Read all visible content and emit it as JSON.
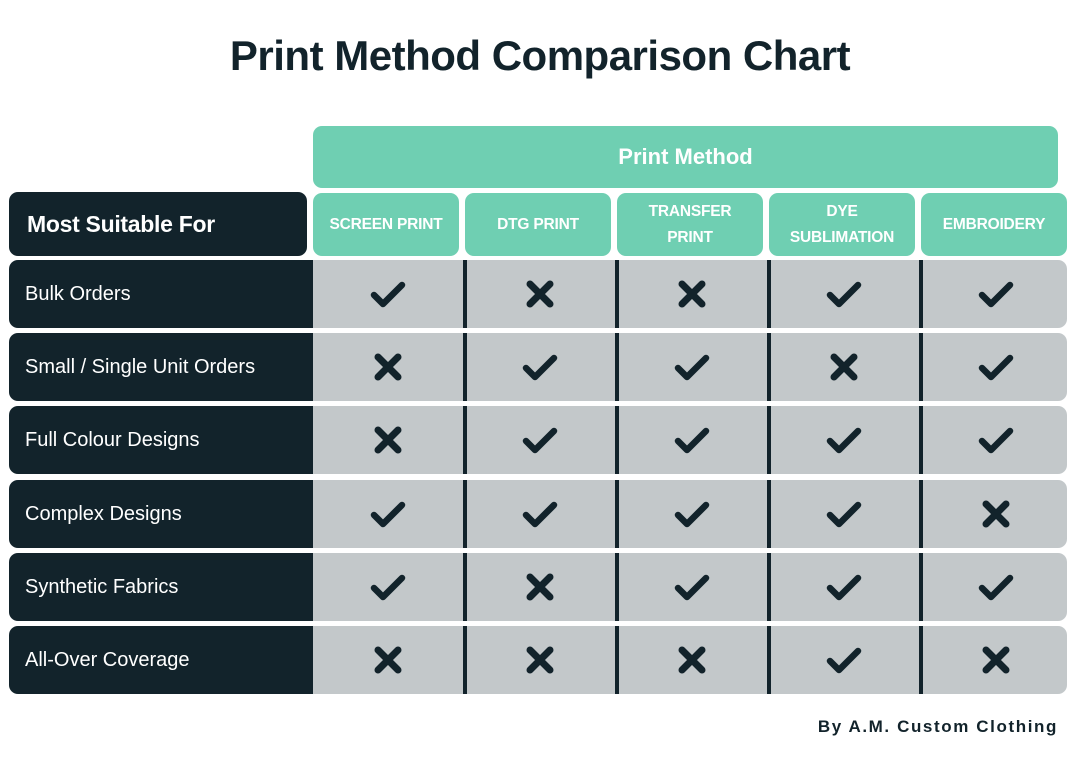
{
  "chart_data": {
    "type": "table",
    "title": "Print Method Comparison Chart",
    "column_group_label": "Print Method",
    "row_header_label": "Most Suitable For",
    "columns": [
      "SCREEN PRINT",
      "DTG PRINT",
      "TRANSFER PRINT",
      "DYE SUBLIMATION",
      "EMBROIDERY"
    ],
    "rows": [
      {
        "label": "Bulk Orders",
        "values": [
          true,
          false,
          false,
          true,
          true
        ]
      },
      {
        "label": "Small / Single Unit Orders",
        "values": [
          false,
          true,
          true,
          false,
          true
        ]
      },
      {
        "label": "Full Colour Designs",
        "values": [
          false,
          true,
          true,
          true,
          true
        ]
      },
      {
        "label": "Complex Designs",
        "values": [
          true,
          true,
          true,
          true,
          false
        ]
      },
      {
        "label": "Synthetic Fabrics",
        "values": [
          true,
          false,
          true,
          true,
          true
        ]
      },
      {
        "label": "All-Over Coverage",
        "values": [
          false,
          false,
          false,
          true,
          false
        ]
      }
    ],
    "legend": {
      "true": "check-icon (suitable)",
      "false": "cross-icon (not suitable)"
    }
  },
  "header": {
    "title": "Print Method Comparison Chart",
    "group_label": "Print Method",
    "row_header": "Most Suitable For",
    "columns": [
      {
        "line1": "SCREEN PRINT",
        "line2": ""
      },
      {
        "line1": "DTG PRINT",
        "line2": ""
      },
      {
        "line1": "TRANSFER",
        "line2": "PRINT"
      },
      {
        "line1": "DYE",
        "line2": "SUBLIMATION"
      },
      {
        "line1": "EMBROIDERY",
        "line2": ""
      }
    ]
  },
  "footer": {
    "credit": "By A.M. Custom Clothing"
  },
  "colors": {
    "accent": "#6fcfb2",
    "dark": "#12232b",
    "cell_bg": "#c3c8ca"
  }
}
